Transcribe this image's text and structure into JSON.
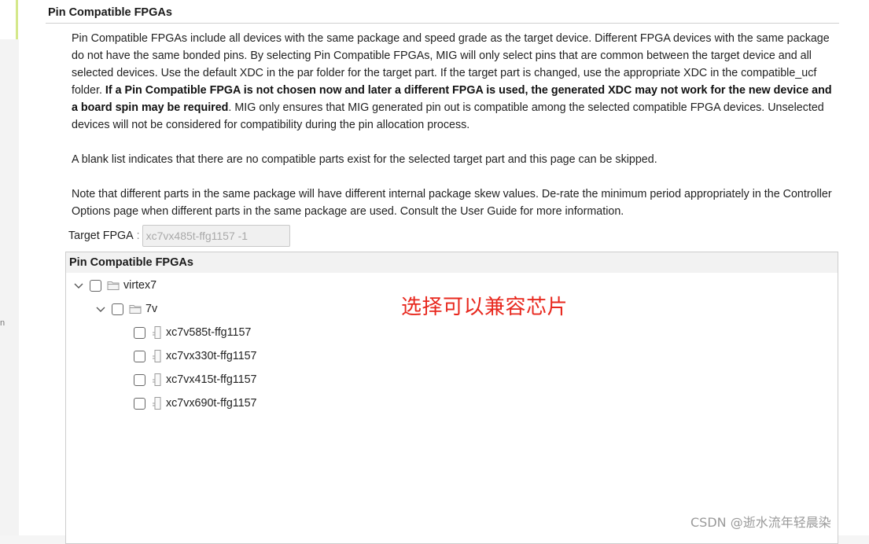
{
  "section": {
    "title": "Pin Compatible FPGAs"
  },
  "description": {
    "p1_part1": "Pin Compatible FPGAs include all devices with the same package and speed grade as the target device. Different FPGA devices with the same package do not have the same bonded pins. By selecting Pin Compatible FPGAs, MIG will only select pins that are common between the target device and all selected devices. Use the default XDC in the par folder for the target part. If the target part is changed, use the appropriate XDC in the compatible_ucf folder. ",
    "p1_bold": "If a Pin Compatible FPGA is not chosen now and later a different FPGA is used, the generated XDC may not work for the new device and a board spin may be required",
    "p1_part2": ". MIG only ensures that MIG generated pin out is compatible among the selected compatible FPGA devices. Unselected devices will not be considered for compatibility during the pin allocation process.",
    "p2": "A blank list indicates that there are no compatible parts exist for the selected target part and this page can be skipped.",
    "p3": "Note that different parts in the same package will have different internal package skew values. De-rate the minimum period appropriately in the Controller Options page when different parts in the same package are used. Consult the User Guide for more information."
  },
  "target": {
    "label": "Target FPGA",
    "colon": ":",
    "value": "xc7vx485t-ffg1157 -1"
  },
  "tree": {
    "header": "Pin Compatible FPGAs",
    "family": {
      "label": "virtex7",
      "checked": false,
      "expanded": true
    },
    "subfamily": {
      "label": "7v",
      "checked": false,
      "expanded": true
    },
    "devices": [
      {
        "label": "xc7v585t-ffg1157",
        "checked": false
      },
      {
        "label": "xc7vx330t-ffg1157",
        "checked": false
      },
      {
        "label": "xc7vx415t-ffg1157",
        "checked": false
      },
      {
        "label": "xc7vx690t-ffg1157",
        "checked": false
      }
    ]
  },
  "annotation": "选择可以兼容芯片",
  "watermark": "CSDN @逝水流年轻晨染",
  "left_stub": "n",
  "colors": {
    "annotation": "#e8281e",
    "accent": "#d4e88a",
    "input_text": "#a9a9a9"
  },
  "icons": {
    "expand": "chevron-down-icon",
    "folder": "folder-icon",
    "device": "chip-icon"
  }
}
